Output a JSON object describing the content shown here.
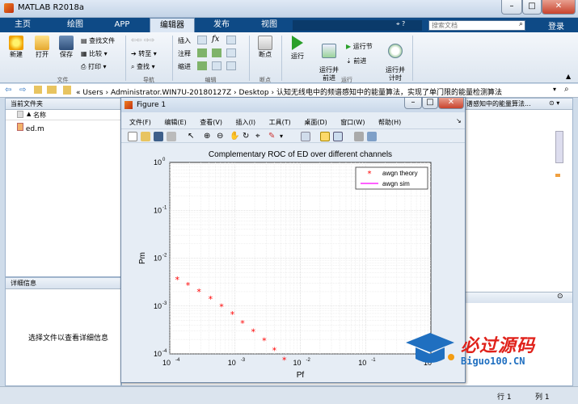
{
  "window": {
    "title": "MATLAB R2018a",
    "minimize": "–",
    "maximize": "□",
    "close": "✕"
  },
  "tabs": [
    {
      "label": "主页"
    },
    {
      "label": "绘图"
    },
    {
      "label": "APP"
    },
    {
      "label": "编辑器",
      "active": true
    },
    {
      "label": "发布"
    },
    {
      "label": "视图"
    }
  ],
  "search": {
    "placeholder": "搜索文档",
    "login": "登录"
  },
  "ribbon": {
    "file": {
      "new": "新建",
      "open": "打开",
      "save": "保存",
      "find_files": "查找文件",
      "compare": "比较",
      "print": "打印",
      "group": "文件"
    },
    "navigate": {
      "goto": "转至",
      "find": "查找",
      "group": "导航"
    },
    "edit": {
      "insert": "插入",
      "comment": "注释",
      "indent": "缩进",
      "fx": "fx",
      "group": "编辑"
    },
    "breakpoints": {
      "label": "断点",
      "group": "断点"
    },
    "run": {
      "run": "运行",
      "run_advance": "运行并\n前进",
      "run_section": "运行节",
      "advance": "前进",
      "run_time": "运行并\n计时",
      "group": "运行"
    }
  },
  "address": {
    "path": [
      "Users",
      "Administrator.WIN7U-20180127Z",
      "Desktop",
      "认知无线电中的频谱感知中的能量算法，实现了单门限的能量检测算法"
    ],
    "sep": "›",
    "lead": "«"
  },
  "current_folder": {
    "title": "当前文件夹",
    "column": "名称",
    "files": [
      "ed.m"
    ]
  },
  "details": {
    "title": "详细信息",
    "empty": "选择文件以查看详细信息"
  },
  "right_header": "谱感知中的能量算法...",
  "figure": {
    "title": "Figure 1",
    "menus": [
      "文件(F)",
      "编辑(E)",
      "查看(V)",
      "插入(I)",
      "工具(T)",
      "桌面(D)",
      "窗口(W)",
      "帮助(H)"
    ]
  },
  "chart_data": {
    "type": "scatter",
    "title": "Complementary ROC of ED over different channels",
    "xlabel": "Pf",
    "ylabel": "Pm",
    "xscale": "log",
    "yscale": "log",
    "xlim": [
      0.0001,
      1
    ],
    "ylim": [
      0.0001,
      1
    ],
    "grid": true,
    "legend_position": "top-right",
    "xticks": [
      "10",
      "10",
      "10",
      "10",
      "10"
    ],
    "xtick_exp": [
      "-4",
      "-3",
      "-2",
      "-1",
      "0"
    ],
    "yticks": [
      "10",
      "10",
      "10",
      "10",
      "10"
    ],
    "ytick_exp": [
      "-4",
      "-3",
      "-2",
      "-1",
      "0"
    ],
    "series": [
      {
        "name": "awgn theory",
        "marker": "*",
        "color": "#ff0000",
        "x": [
          0.00013,
          0.00019,
          0.00028,
          0.00042,
          0.00062,
          0.00091,
          0.0013,
          0.0019,
          0.0028,
          0.004,
          0.0057
        ],
        "y": [
          0.0036,
          0.0027,
          0.002,
          0.0014,
          0.00098,
          0.00067,
          0.00044,
          0.00029,
          0.00019,
          0.00012,
          7.5e-05
        ]
      },
      {
        "name": "awgn sim",
        "marker": "line",
        "color": "#ff00ff",
        "x": [],
        "y": []
      }
    ]
  },
  "status": {
    "row_label": "行",
    "row": "1",
    "col_label": "列",
    "col": "1"
  },
  "watermark": {
    "cn": "必过源码",
    "en": "Biguo100.CN"
  }
}
